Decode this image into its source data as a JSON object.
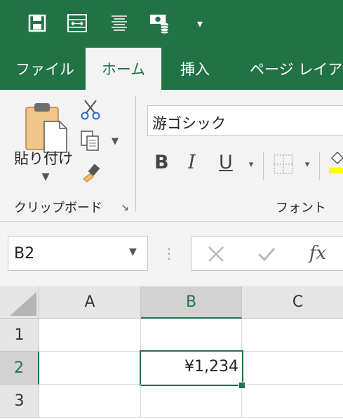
{
  "quick_access": {
    "buttons": [
      {
        "icon": "save-icon"
      },
      {
        "icon": "form-icon"
      },
      {
        "icon": "align-lines-icon"
      },
      {
        "icon": "currency-icon"
      },
      {
        "icon": "customize-dropdown-icon",
        "label": "▾"
      }
    ]
  },
  "tabs": [
    {
      "label": "ファイル",
      "active": false
    },
    {
      "label": "ホーム",
      "active": true
    },
    {
      "label": "挿入",
      "active": false
    },
    {
      "label": "ページ レイアウト",
      "active": false
    }
  ],
  "ribbon": {
    "clipboard": {
      "paste_label": "貼り付け",
      "group_label": "クリップボード",
      "dialog_launcher": "↘"
    },
    "font": {
      "font_name": "游ゴシック",
      "bold": "B",
      "italic": "I",
      "underline": "U",
      "group_label": "フォント",
      "dropdown": "▾"
    }
  },
  "formula_bar": {
    "name_box": "B2",
    "fx_label": "fx",
    "formula": ""
  },
  "grid": {
    "columns": [
      "A",
      "B",
      "C"
    ],
    "rows": [
      "1",
      "2",
      "3"
    ],
    "selected_cell": "B2",
    "cells": {
      "B2": "¥1,234"
    }
  },
  "colors": {
    "excel_green": "#217346",
    "ribbon_bg": "#f3f3f3",
    "highlight_yellow": "#ffff00"
  }
}
